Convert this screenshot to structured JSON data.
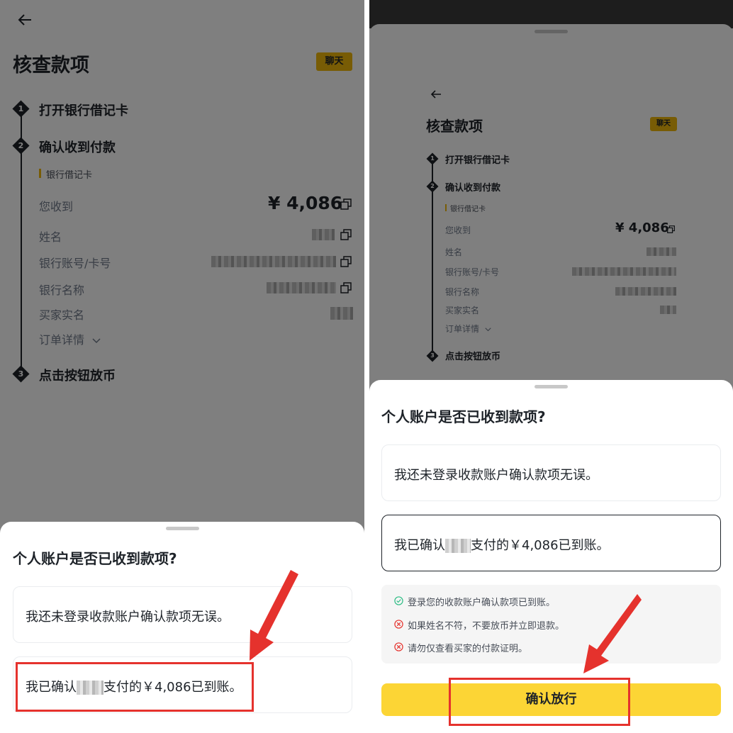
{
  "page": {
    "title": "核查款项",
    "chat_label": "聊天",
    "back_icon": "arrow-left-icon"
  },
  "steps": [
    {
      "num": "1",
      "label": "打开银行借记卡"
    },
    {
      "num": "2",
      "label": "确认收到付款"
    },
    {
      "num": "3",
      "label": "点击按钮放币"
    }
  ],
  "payment": {
    "method_tag": "银行借记卡",
    "received_label": "您收到",
    "amount": "¥ 4,086",
    "name_label": "姓名",
    "account_label": "银行账号/卡号",
    "bank_label": "银行名称",
    "buyer_label": "买家实名",
    "order_details_label": "订单详情",
    "order_details_icon": "chevron-down-icon"
  },
  "sheet": {
    "question": "个人账户是否已收到款项?",
    "option_not_logged": "我还未登录收款账户确认款项无误。",
    "option_confirm_prefix": "我已确认",
    "option_confirm_suffix": "支付的￥4,086已到账。",
    "option_confirm_suffix_left": "支付的￥4,086已到账。"
  },
  "notes": [
    {
      "icon": "check-circle-icon",
      "text": "登录您的收款账户确认款项已到账。"
    },
    {
      "icon": "x-circle-icon",
      "text": "如果姓名不符，不要放币并立即退款。"
    },
    {
      "icon": "x-circle-icon",
      "text": "请勿仅查看买家的付款证明。"
    }
  ],
  "confirm_button": "确认放行",
  "colors": {
    "brand_yellow": "#fcd535",
    "tag_yellow": "#f0b90b",
    "annotation_red": "#e5322d",
    "check_green": "#2ebd85",
    "error_red": "#e5322d"
  }
}
